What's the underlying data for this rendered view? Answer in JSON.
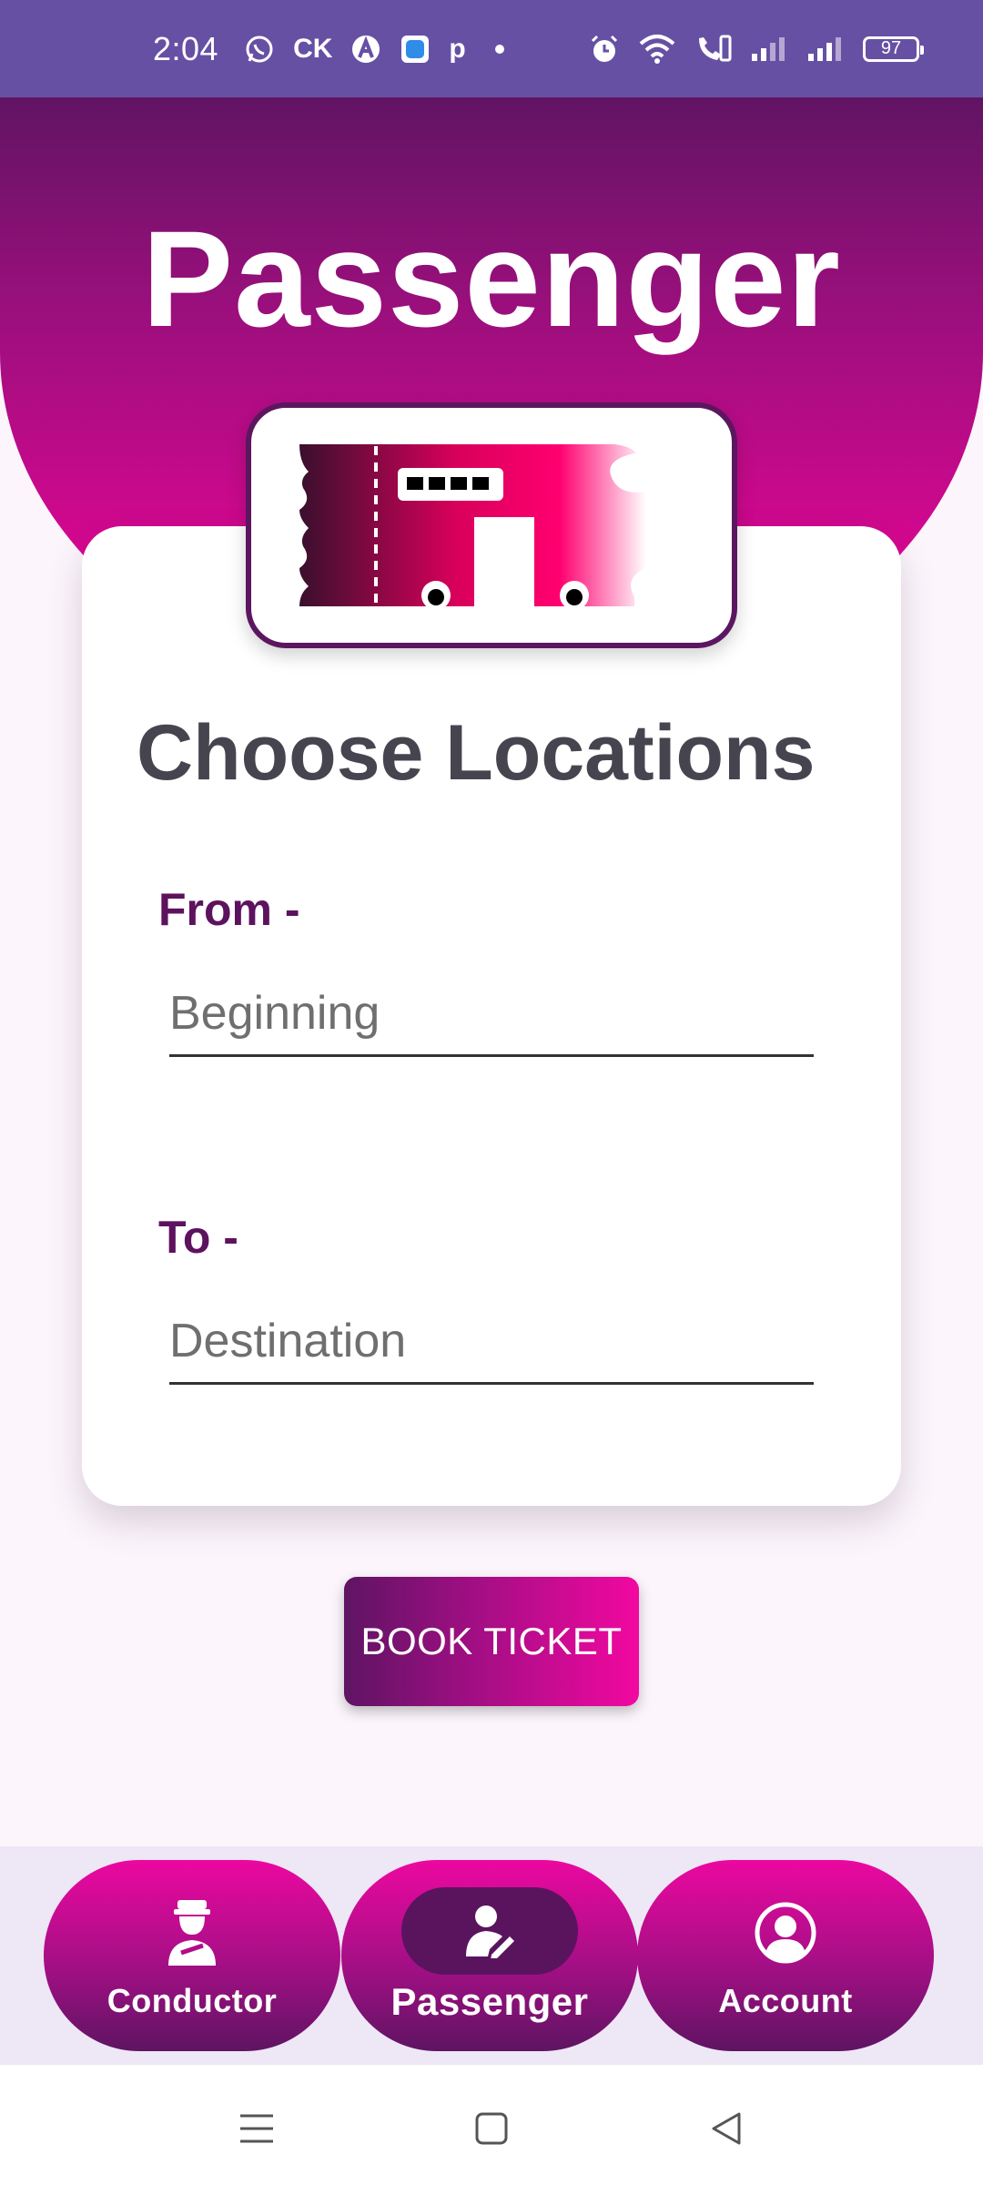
{
  "status_bar": {
    "time": "2:04",
    "left_icons": [
      "whatsapp-icon",
      "ck-icon",
      "app-a-icon",
      "app-square-icon",
      "p-icon",
      "dot-icon"
    ],
    "ck_text": "CK",
    "p_text": "p",
    "battery": "97",
    "bar_color": "#6650a4"
  },
  "header": {
    "title": "Passenger",
    "gradient_top": "#611463",
    "gradient_bottom": "#e8058f"
  },
  "card": {
    "title": "Choose Locations",
    "from_label": "From -",
    "from_placeholder": "Beginning",
    "from_value": "",
    "to_label": "To -",
    "to_placeholder": "Destination",
    "to_value": ""
  },
  "book_button": {
    "label": "BOOK TICKET"
  },
  "bottom_nav": {
    "items": [
      {
        "label": "Conductor",
        "icon": "conductor-icon",
        "active": false
      },
      {
        "label": "Passenger",
        "icon": "passenger-icon",
        "active": true
      },
      {
        "label": "Account",
        "icon": "account-icon",
        "active": false
      }
    ],
    "background": "#eee7f6"
  },
  "system_nav": [
    "menu-icon",
    "home-icon",
    "back-icon"
  ],
  "colors": {
    "accent_dark": "#5d125e",
    "accent_pink": "#f208a0",
    "title_gray": "#46454f"
  }
}
